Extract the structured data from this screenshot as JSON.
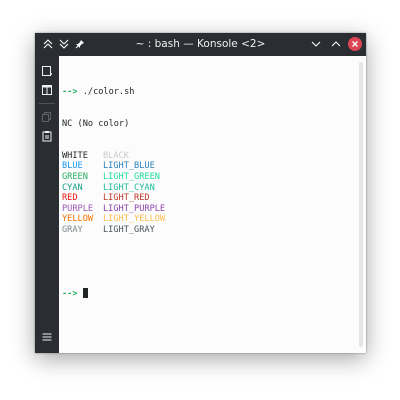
{
  "window": {
    "title": "~ : bash — Konsole <2>"
  },
  "titlebar": {
    "left_icons": [
      "keep-above-icon",
      "keep-below-icon",
      "pin-icon"
    ],
    "right_icons": [
      "minimize-chevron-icon",
      "maximize-chevron-icon",
      "close-icon"
    ]
  },
  "sidebar": {
    "icons": [
      "new-tab-icon",
      "split-view-icon",
      "copy-icon",
      "paste-icon",
      "menu-icon"
    ]
  },
  "terminal": {
    "prompt": "-->",
    "command": "./color.sh",
    "nc_line": "NC (No color)",
    "rows": [
      {
        "left": "WHITE",
        "left_color": "#232627",
        "right": "BLACK",
        "right_color": "#c8cacc"
      },
      {
        "left": "BLUE",
        "left_color": "#1d99f3",
        "right": "LIGHT_BLUE",
        "right_color": "#2980b9"
      },
      {
        "left": "GREEN",
        "left_color": "#27ae60",
        "right": "LIGHT_GREEN",
        "right_color": "#1cdc9a"
      },
      {
        "left": "CYAN",
        "left_color": "#16a085",
        "right": "LIGHT_CYAN",
        "right_color": "#1abc9c"
      },
      {
        "left": "RED",
        "left_color": "#ed1515",
        "right": "LIGHT_RED",
        "right_color": "#c0392b"
      },
      {
        "left": "PURPLE",
        "left_color": "#9b59b6",
        "right": "LIGHT_PURPLE",
        "right_color": "#8e44ad"
      },
      {
        "left": "YELLOW",
        "left_color": "#f67400",
        "right": "LIGHT_YELLOW",
        "right_color": "#fdbc4b"
      },
      {
        "left": "GRAY",
        "left_color": "#7f8c8d",
        "right": "LIGHT_GRAY",
        "right_color": "#4d5359"
      }
    ],
    "prompt2": "-->"
  },
  "colors": {
    "titlebar_bg": "#2a2e32",
    "terminal_bg": "#fcfcfc",
    "close_button": "#da4453",
    "prompt_arrow": "#27ae60"
  }
}
